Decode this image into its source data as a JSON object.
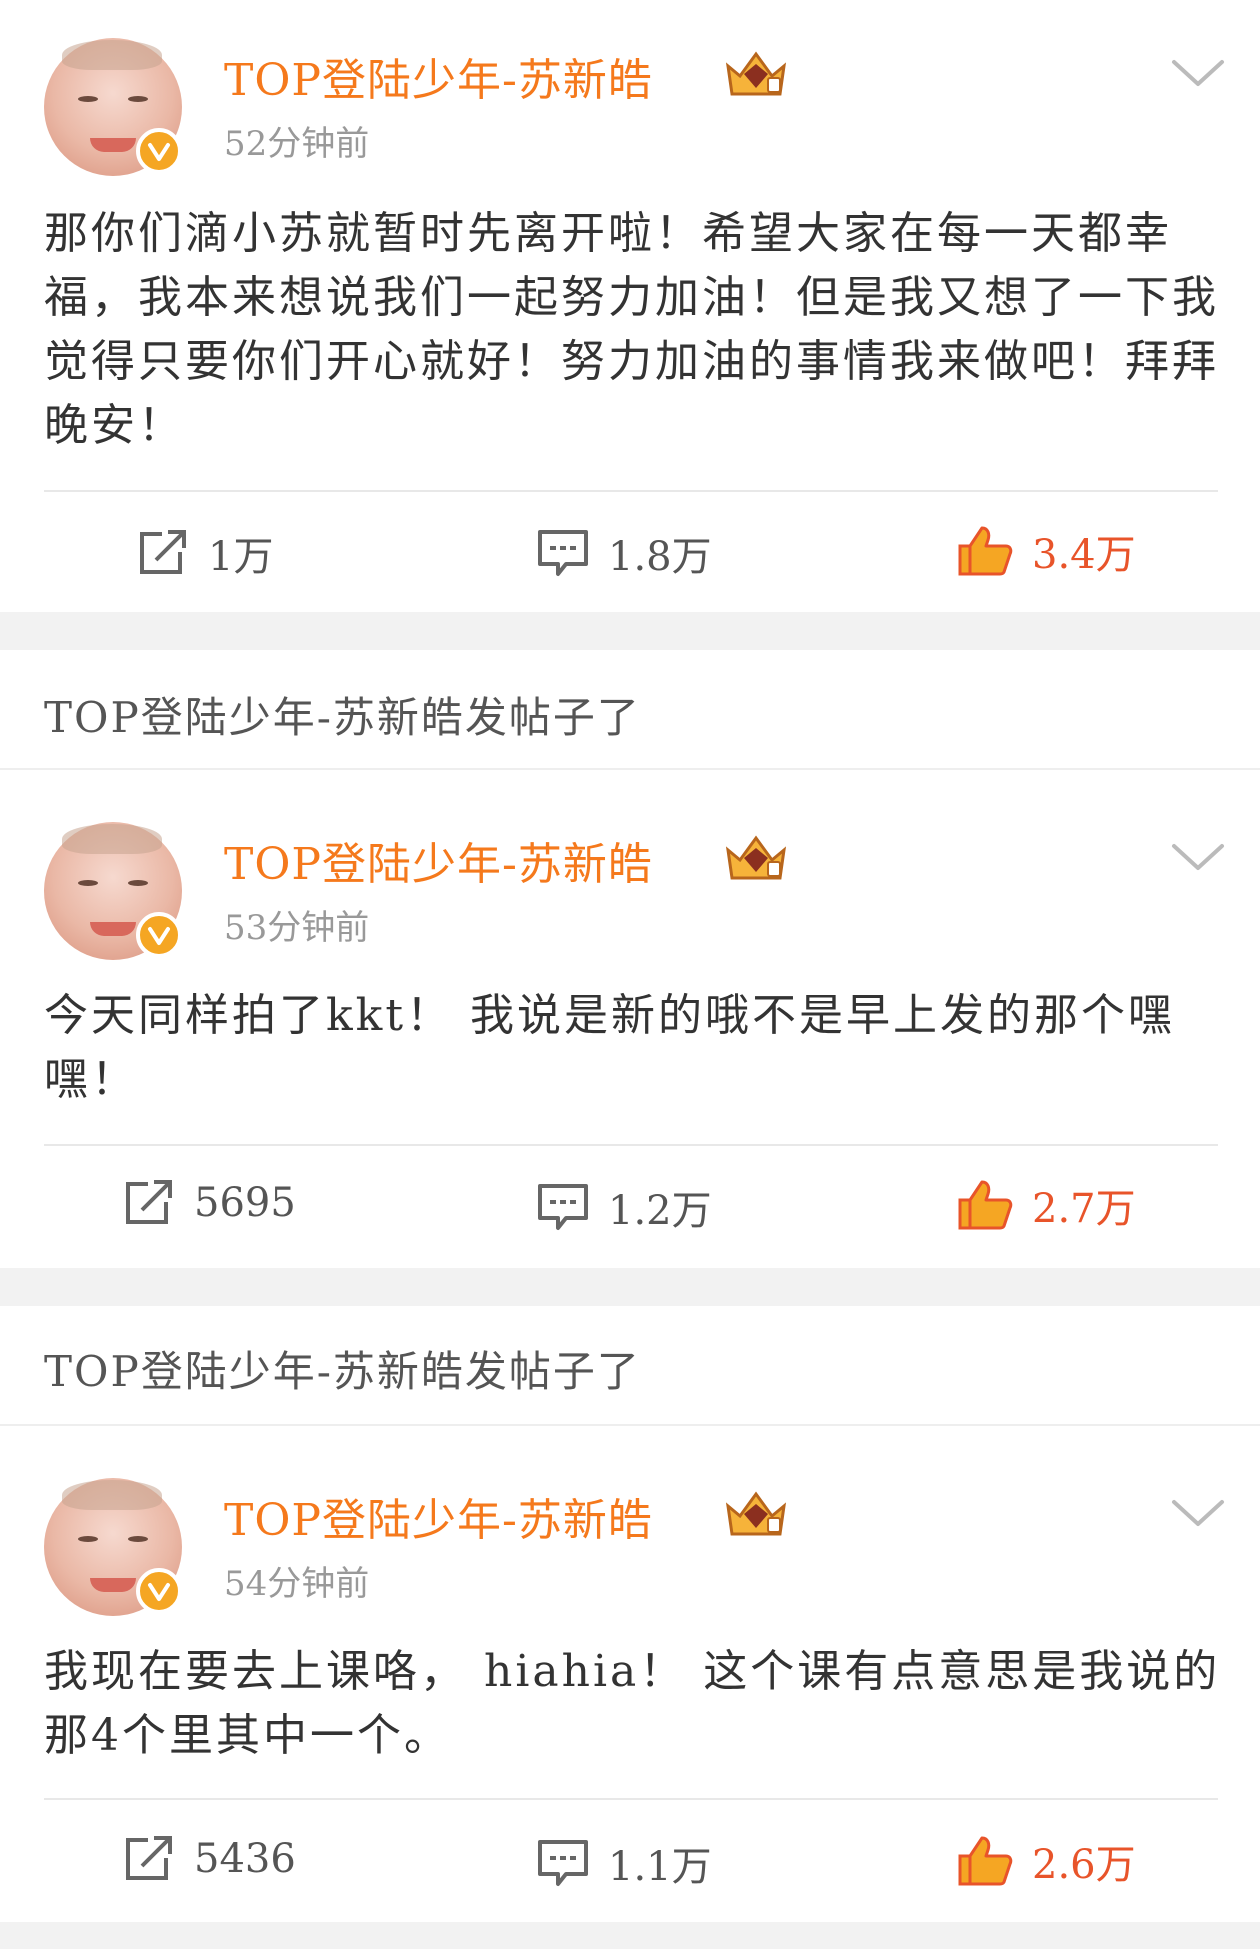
{
  "posts": [
    {
      "username": "TOP登陆少年-苏新皓",
      "time": "52分钟前",
      "text": "那你们滴小苏就暂时先离开啦！希望大家在每一天都幸福，我本来想说我们一起努力加油！但是我又想了一下我觉得只要你们开心就好！努力加油的事情我来做吧！拜拜晚安！",
      "reposts": "1万",
      "comments": "1.8万",
      "likes": "3.4万"
    },
    {
      "username": "TOP登陆少年-苏新皓",
      "time": "53分钟前",
      "text": "今天同样拍了kkt！ 我说是新的哦不是早上发的那个嘿嘿！",
      "reposts": "5695",
      "comments": "1.2万",
      "likes": "2.7万"
    },
    {
      "username": "TOP登陆少年-苏新皓",
      "time": "54分钟前",
      "text": "我现在要去上课咯， hiahia！ 这个课有点意思是我说的那4个里其中一个。",
      "reposts": "5436",
      "comments": "1.1万",
      "likes": "2.6万"
    }
  ],
  "notices": [
    "TOP登陆少年-苏新皓发帖子了",
    "TOP登陆少年-苏新皓发帖子了"
  ],
  "colors": {
    "username": "#f5791c",
    "like": "#e8542a",
    "badge": "#f5a623",
    "separator": "#f2f2f2"
  },
  "icons": [
    "verified-badge-icon",
    "crown-icon",
    "chevron-down-icon",
    "repost-icon",
    "comment-icon",
    "like-icon"
  ]
}
